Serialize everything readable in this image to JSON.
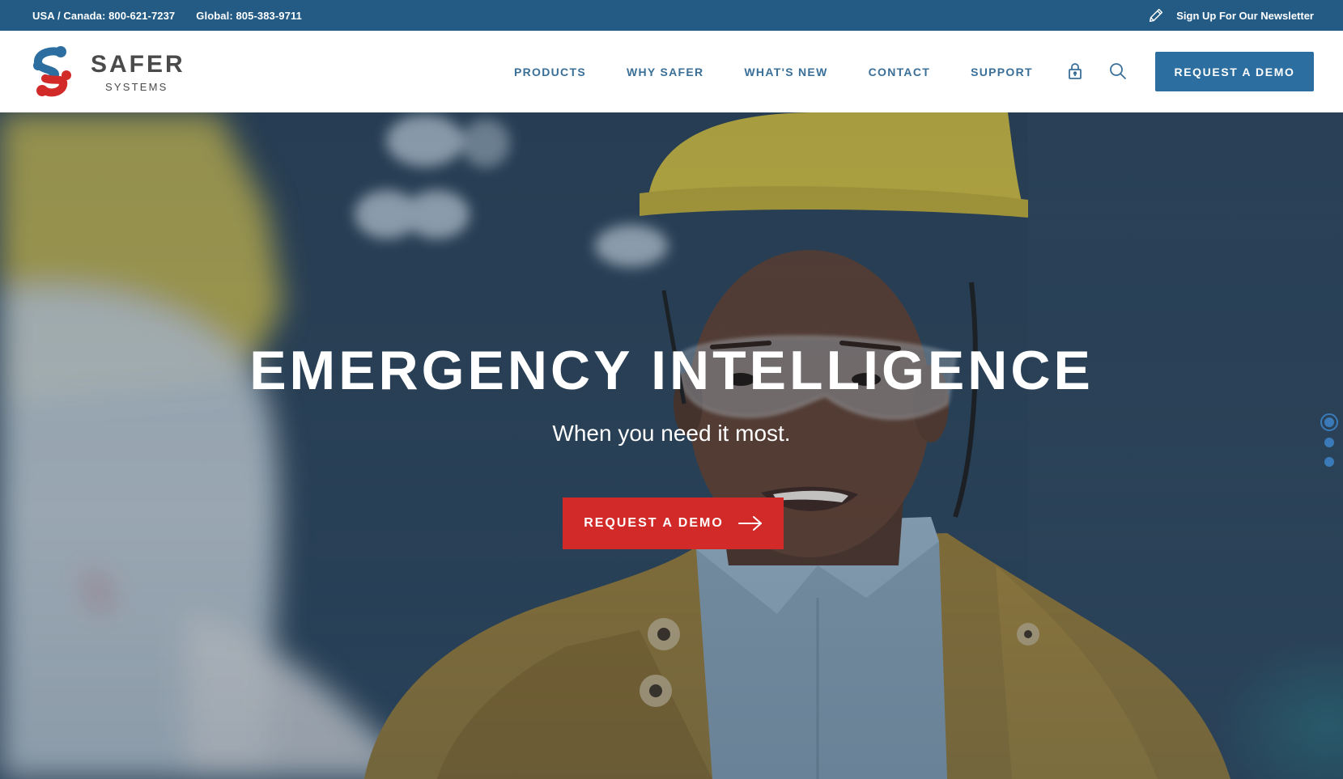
{
  "utility_bar": {
    "phone_usa": "USA / Canada: 800-621-7237",
    "phone_global": "Global: 805-383-9711",
    "newsletter_label": "Sign Up For Our Newsletter",
    "newsletter_icon": "pencil-icon"
  },
  "header": {
    "logo": {
      "word1": "SAFER",
      "word2": "SYSTEMS"
    },
    "nav": [
      {
        "label": "PRODUCTS"
      },
      {
        "label": "WHY SAFER"
      },
      {
        "label": "WHAT'S NEW"
      },
      {
        "label": "CONTACT"
      },
      {
        "label": "SUPPORT"
      }
    ],
    "icons": [
      "lock-icon",
      "search-icon"
    ],
    "demo_button": "REQUEST A DEMO"
  },
  "hero": {
    "title": "EMERGENCY INTELLIGENCE",
    "subtitle": "When you need it most.",
    "cta_label": "REQUEST A DEMO",
    "cta_icon": "arrow-right-icon",
    "slides": {
      "count": 3,
      "active": 1
    }
  },
  "colors": {
    "utility_bar_bg": "#235b84",
    "nav_text": "#3a6f98",
    "header_button_bg": "#2c6ea0",
    "cta_bg": "#d22a28",
    "logo_blue": "#2c6ea0",
    "logo_red": "#d22a28",
    "dot": "#3a7ab8"
  }
}
